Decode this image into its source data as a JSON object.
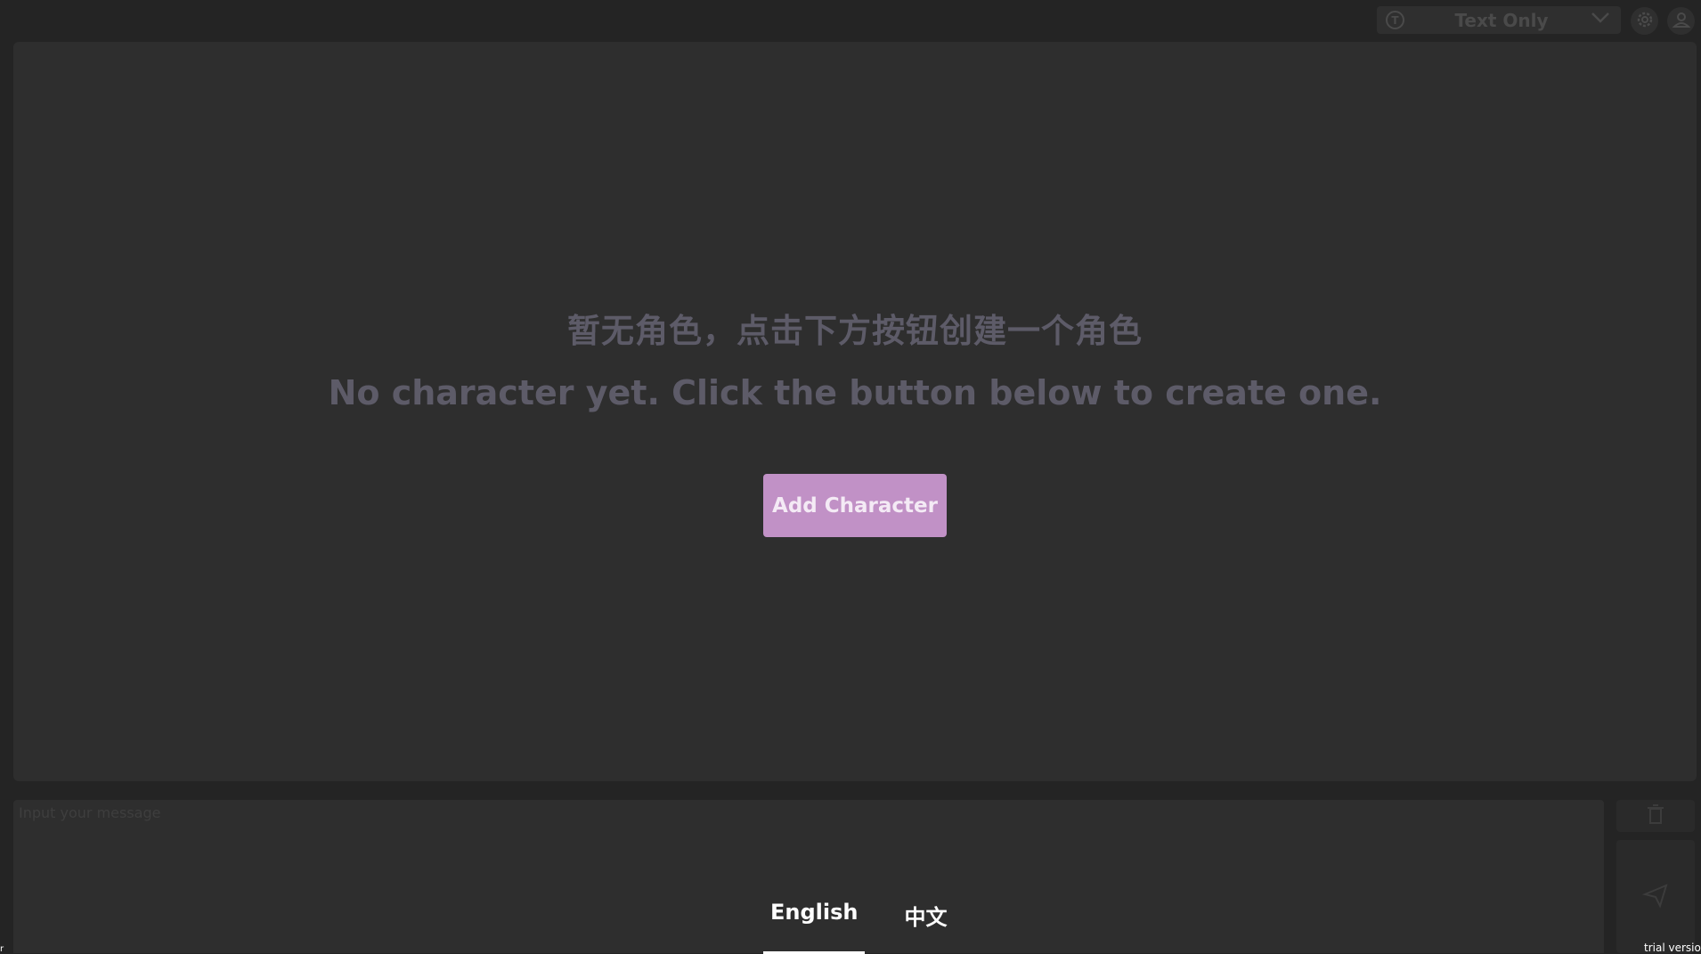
{
  "header": {
    "mode_label": "Text Only",
    "mode_icon": "T"
  },
  "main": {
    "empty_text_zh": "暂无角色，点击下方按钮创建一个角色",
    "empty_text_en": "No character yet. Click the button below to create one.",
    "add_button_label": "Add Character"
  },
  "composer": {
    "placeholder": "Input your message"
  },
  "language": {
    "tabs": [
      "English",
      "中文"
    ],
    "active": "English"
  },
  "footer": {
    "trial_label": "trial versio",
    "corner_mark": "r"
  },
  "colors": {
    "accent": "#c191c6",
    "panel": "#2e2e2e",
    "background": "#242424",
    "muted_text": "#5d5b68"
  }
}
